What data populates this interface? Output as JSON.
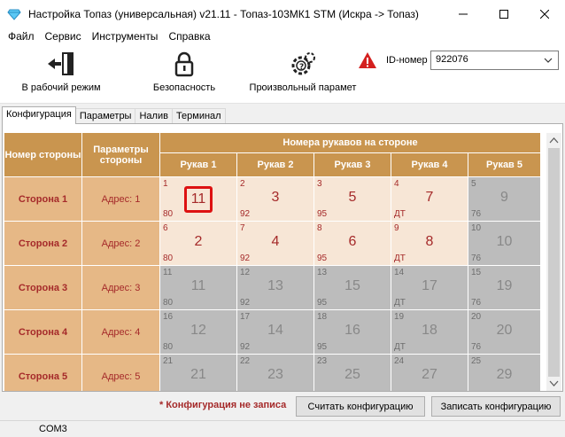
{
  "window": {
    "title": "Настройка Топаз (универсальная) v21.11 - Топаз-103МК1 STM (Искра -> Топаз)",
    "controls": [
      "minimize",
      "maximize",
      "close"
    ]
  },
  "menu": [
    "Файл",
    "Сервис",
    "Инструменты",
    "Справка"
  ],
  "toolbar": {
    "work_mode": "В рабочий режим",
    "security": "Безопасность",
    "custom_param": "Произвольный парамет",
    "id_label": "ID-номер",
    "id_value": "922076"
  },
  "tabs": [
    "Конфигурация",
    "Параметры",
    "Налив",
    "Терминал"
  ],
  "grid": {
    "col_side": "Номер стороны",
    "col_params": "Параметры стороны",
    "hoses_header": "Номера рукавов на стороне",
    "hose_cols": [
      "Рукав 1",
      "Рукав 2",
      "Рукав 3",
      "Рукав 4",
      "Рукав 5"
    ],
    "rows": [
      {
        "side": "Сторона 1",
        "addr": "Адрес: 1",
        "hoses": [
          {
            "tl": "1",
            "big": "11",
            "bl": "80",
            "state": "on",
            "selected": true
          },
          {
            "tl": "2",
            "big": "3",
            "bl": "92",
            "state": "on"
          },
          {
            "tl": "3",
            "big": "5",
            "bl": "95",
            "state": "on"
          },
          {
            "tl": "4",
            "big": "7",
            "bl": "ДТ",
            "state": "on"
          },
          {
            "tl": "5",
            "big": "9",
            "bl": "76",
            "state": "off"
          }
        ]
      },
      {
        "side": "Сторона 2",
        "addr": "Адрес: 2",
        "hoses": [
          {
            "tl": "6",
            "big": "2",
            "bl": "80",
            "state": "on"
          },
          {
            "tl": "7",
            "big": "4",
            "bl": "92",
            "state": "on"
          },
          {
            "tl": "8",
            "big": "6",
            "bl": "95",
            "state": "on"
          },
          {
            "tl": "9",
            "big": "8",
            "bl": "ДТ",
            "state": "on"
          },
          {
            "tl": "10",
            "big": "10",
            "bl": "76",
            "state": "off"
          }
        ]
      },
      {
        "side": "Сторона 3",
        "addr": "Адрес: 3",
        "hoses": [
          {
            "tl": "11",
            "big": "11",
            "bl": "80",
            "state": "off"
          },
          {
            "tl": "12",
            "big": "13",
            "bl": "92",
            "state": "off"
          },
          {
            "tl": "13",
            "big": "15",
            "bl": "95",
            "state": "off"
          },
          {
            "tl": "14",
            "big": "17",
            "bl": "ДТ",
            "state": "off"
          },
          {
            "tl": "15",
            "big": "19",
            "bl": "76",
            "state": "off"
          }
        ]
      },
      {
        "side": "Сторона 4",
        "addr": "Адрес: 4",
        "hoses": [
          {
            "tl": "16",
            "big": "12",
            "bl": "80",
            "state": "off"
          },
          {
            "tl": "17",
            "big": "14",
            "bl": "92",
            "state": "off"
          },
          {
            "tl": "18",
            "big": "16",
            "bl": "95",
            "state": "off"
          },
          {
            "tl": "19",
            "big": "18",
            "bl": "ДТ",
            "state": "off"
          },
          {
            "tl": "20",
            "big": "20",
            "bl": "76",
            "state": "off"
          }
        ]
      },
      {
        "side": "Сторона 5",
        "addr": "Адрес: 5",
        "hoses": [
          {
            "tl": "21",
            "big": "21",
            "bl": "",
            "state": "off"
          },
          {
            "tl": "22",
            "big": "23",
            "bl": "",
            "state": "off"
          },
          {
            "tl": "23",
            "big": "25",
            "bl": "",
            "state": "off"
          },
          {
            "tl": "24",
            "big": "27",
            "bl": "",
            "state": "off"
          },
          {
            "tl": "25",
            "big": "29",
            "bl": "",
            "state": "off"
          }
        ]
      }
    ]
  },
  "footer": {
    "warning": "* Конфигурация не записа",
    "read_btn": "Считать конфигурацию",
    "write_btn": "Записать конфигурацию"
  },
  "status": {
    "port": "COM3"
  }
}
